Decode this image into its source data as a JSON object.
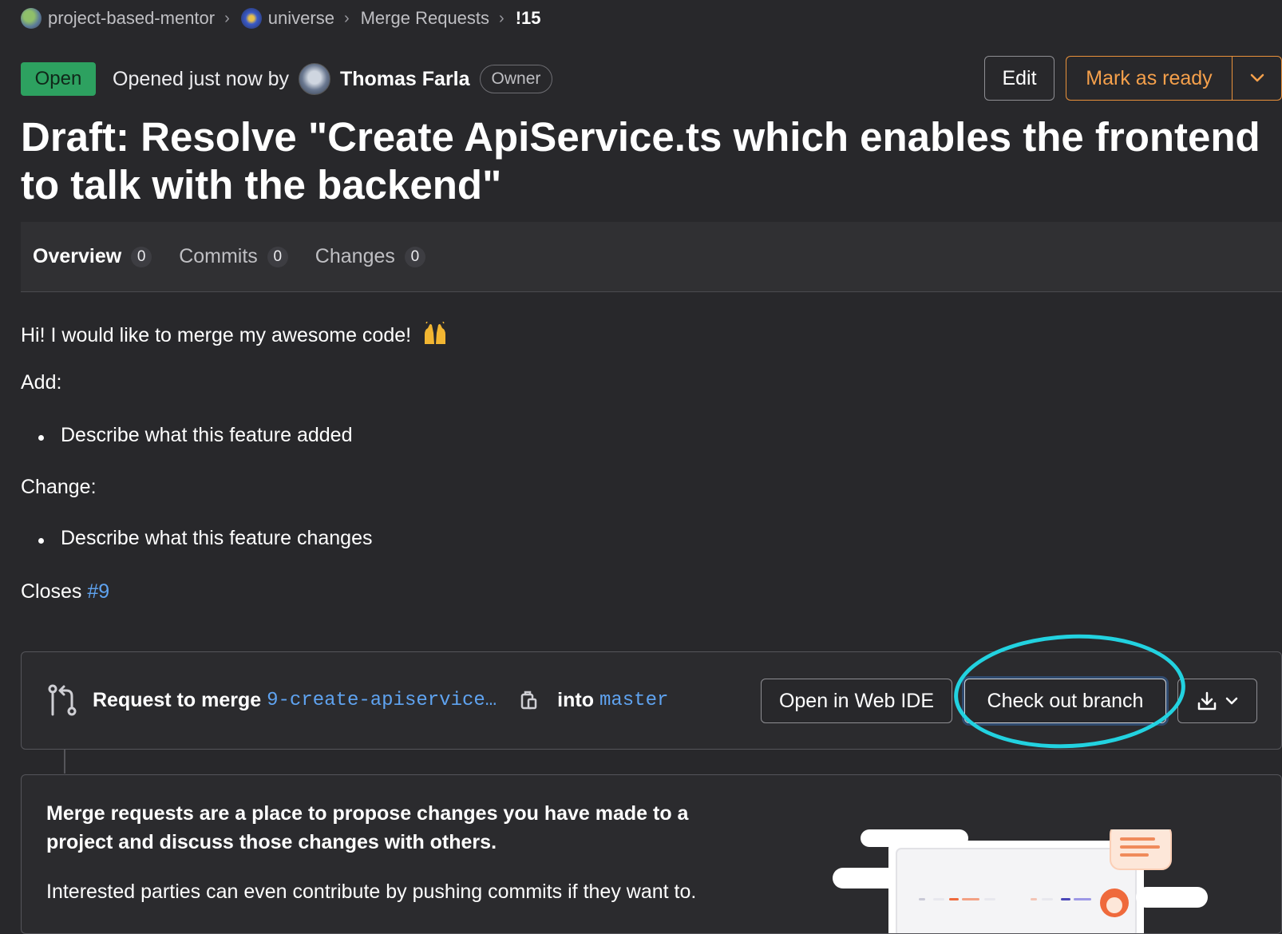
{
  "breadcrumb": {
    "project": "project-based-mentor",
    "repo": "universe",
    "section": "Merge Requests",
    "current": "!15"
  },
  "header": {
    "status": "Open",
    "opened_text": "Opened just now by",
    "author": "Thomas Farla",
    "role": "Owner",
    "edit_label": "Edit",
    "ready_label": "Mark as ready"
  },
  "title": "Draft: Resolve \"Create ApiService.ts which enables the frontend to talk with the backend\"",
  "tabs": [
    {
      "label": "Overview",
      "count": "0"
    },
    {
      "label": "Commits",
      "count": "0"
    },
    {
      "label": "Changes",
      "count": "0"
    }
  ],
  "description": {
    "intro": "Hi! I would like to merge my awesome code!",
    "add_heading": "Add:",
    "add_item": "Describe what this feature added",
    "change_heading": "Change:",
    "change_item": "Describe what this feature changes",
    "closes_label": "Closes",
    "closes_link": "#9"
  },
  "merge_widget": {
    "request_label": "Request to merge",
    "source_branch": "9-create-apiservice…",
    "into_label": "into",
    "target_branch": "master",
    "web_ide_label": "Open in Web IDE",
    "checkout_label": "Check out branch"
  },
  "info": {
    "heading": "Merge requests are a place to propose changes you have made to a project and discuss those changes with others.",
    "body": "Interested parties can even contribute by pushing commits if they want to."
  },
  "colors": {
    "status_green": "#2da160",
    "accent_orange": "#e9913b",
    "link_blue": "#5fa3f0",
    "highlight_cyan": "#22d2e0"
  }
}
